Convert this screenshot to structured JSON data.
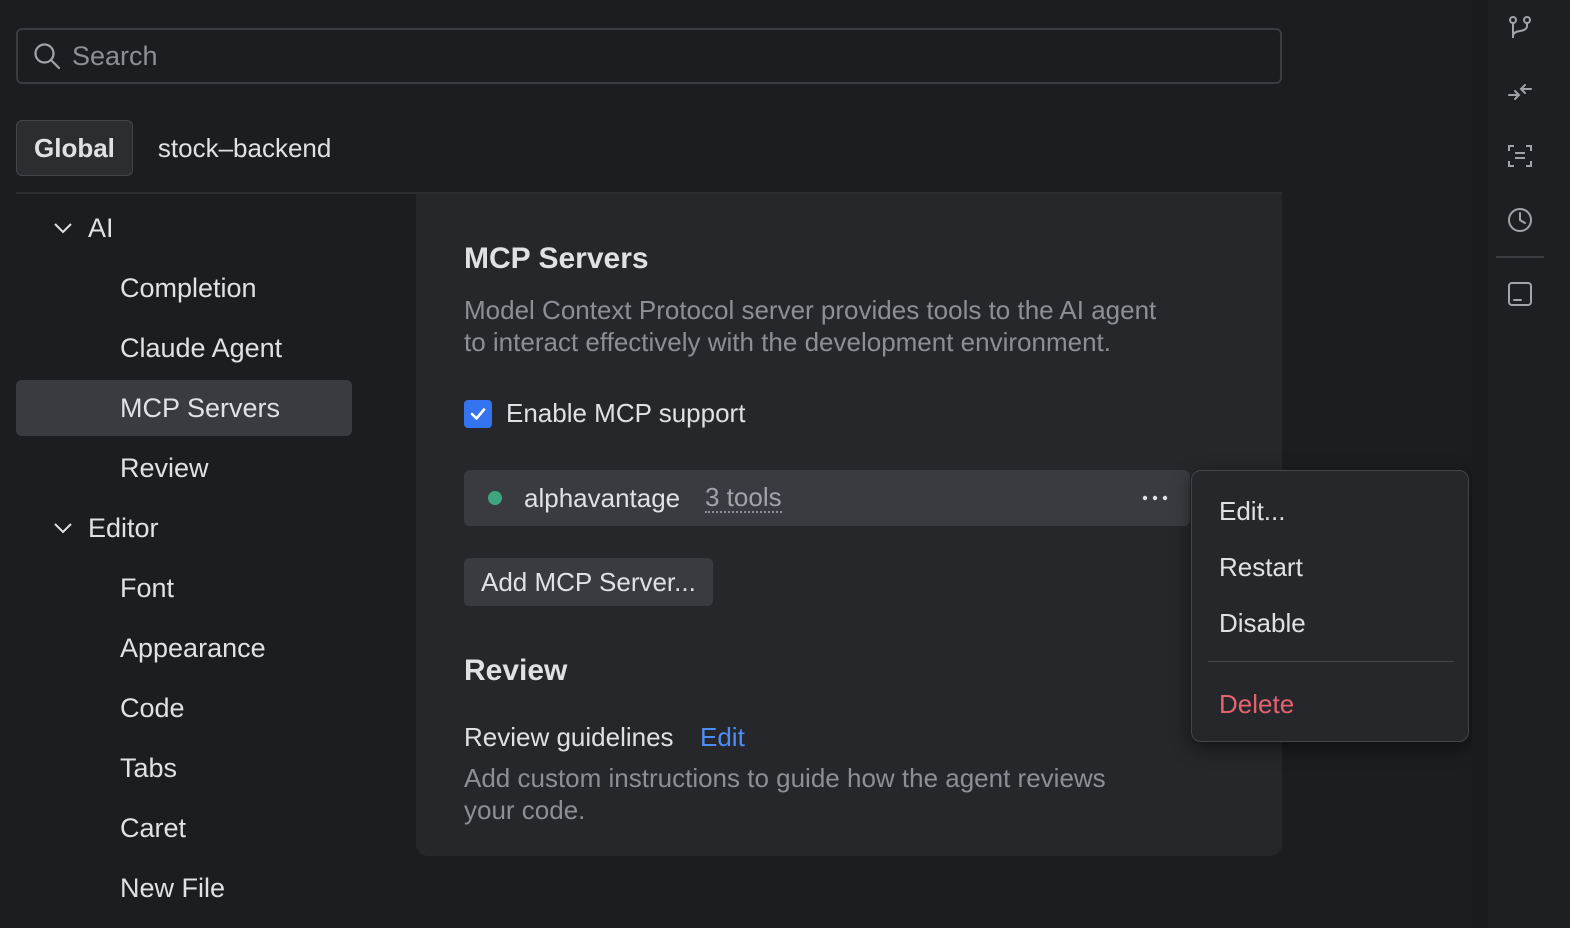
{
  "search": {
    "placeholder": "Search"
  },
  "scope_tabs": [
    {
      "label": "Global",
      "active": true
    },
    {
      "label": "stock–backend",
      "active": false
    }
  ],
  "tree": {
    "ai": {
      "label": "AI",
      "children": [
        "Completion",
        "Claude Agent",
        "MCP Servers",
        "Review"
      ],
      "selected": "MCP Servers"
    },
    "editor": {
      "label": "Editor",
      "children": [
        "Font",
        "Appearance",
        "Code",
        "Tabs",
        "Caret",
        "New File"
      ]
    }
  },
  "mcp": {
    "title": "MCP Servers",
    "description_line1": "Model Context Protocol server provides tools to the AI agent",
    "description_line2": "to interact effectively with the development environment.",
    "enable_label": "Enable MCP support",
    "enabled": true,
    "server": {
      "name": "alphavantage",
      "tools": "3 tools",
      "status_color": "#3fa57f"
    },
    "add_button": "Add MCP Server..."
  },
  "review": {
    "title": "Review",
    "guidelines_label": "Review guidelines",
    "edit_link": "Edit",
    "description_line1": "Add custom instructions to guide how the agent reviews",
    "description_line2": "your code."
  },
  "context_menu": {
    "items": [
      "Edit...",
      "Restart",
      "Disable"
    ],
    "danger_item": "Delete",
    "danger_color": "#e5626f"
  },
  "right_bar_icons": [
    "branch-icon",
    "collapse-icon",
    "scan-icon",
    "clock-icon",
    "panel-icon"
  ],
  "colors": {
    "accent": "#3574f0",
    "link": "#4c8ef5"
  }
}
